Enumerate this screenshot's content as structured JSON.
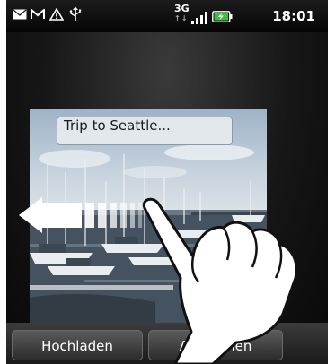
{
  "statusbar": {
    "network": "3G",
    "time": "18:01",
    "icons": [
      "mail-icon",
      "gmail-icon",
      "warning-icon",
      "usb-icon",
      "network-3g-icon",
      "signal-icon",
      "battery-icon"
    ]
  },
  "photo": {
    "caption_placeholder": "Trip to Seattle..."
  },
  "buttons": {
    "upload_label": "Hochladen",
    "cancel_label": "Abbrechen"
  },
  "overlay": {
    "gesture": "swipe-left",
    "icons": [
      "swipe-left-arrow-icon",
      "hand-icon"
    ]
  }
}
